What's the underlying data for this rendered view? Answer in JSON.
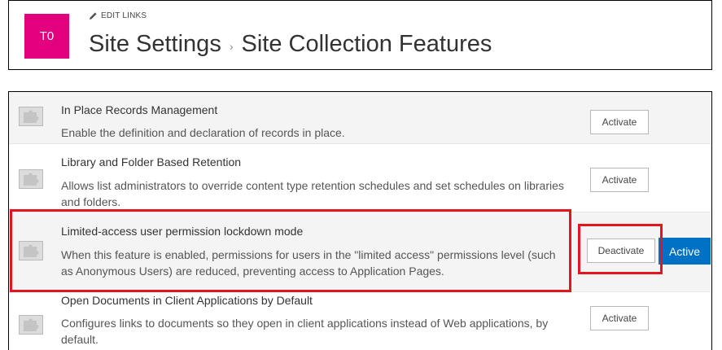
{
  "header": {
    "logo_text": "T0",
    "edit_links": "EDIT LINKS",
    "breadcrumb": [
      "Site Settings",
      "Site Collection Features"
    ],
    "separator": "›"
  },
  "features": [
    {
      "title": "In Place Records Management",
      "description": "Enable the definition and declaration of records in place.",
      "button": "Activate",
      "status": ""
    },
    {
      "title": "Library and Folder Based Retention",
      "description": "Allows list administrators to override content type retention schedules and set schedules on libraries and folders.",
      "button": "Activate",
      "status": ""
    },
    {
      "title": "Limited-access user permission lockdown mode",
      "description": "When this feature is enabled, permissions for users in the \"limited access\" permissions level (such as Anonymous Users) are reduced, preventing access to Application Pages.",
      "button": "Deactivate",
      "status": "Active"
    },
    {
      "title": "Open Documents in Client Applications by Default",
      "description": "Configures links to documents so they open in client applications instead of Web applications, by default.",
      "button": "Activate",
      "status": ""
    }
  ],
  "colors": {
    "logo_bg": "#e3007e",
    "active_badge": "#0072c6",
    "highlight": "#e3161e"
  },
  "icons": [
    "pencil-icon",
    "feature-puzzle-icon"
  ]
}
